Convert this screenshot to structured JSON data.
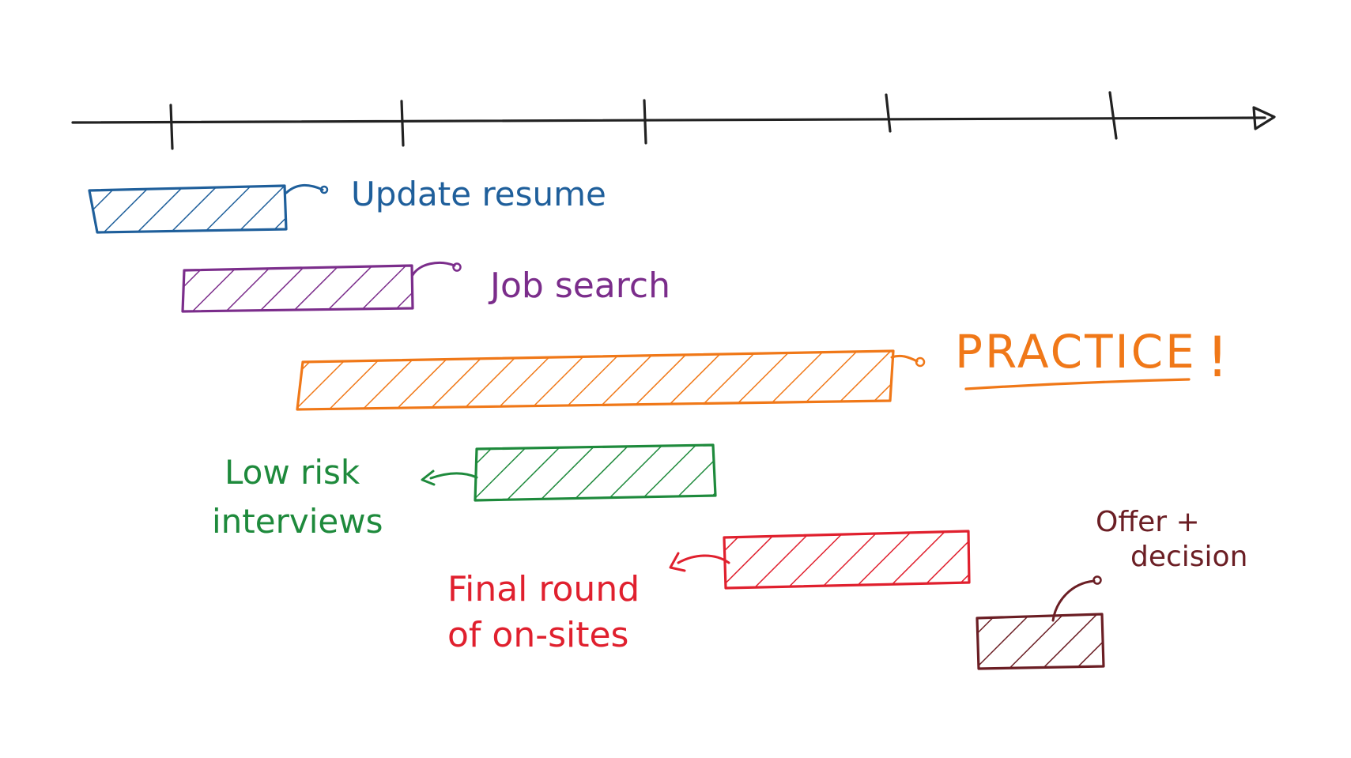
{
  "timeline": {
    "tick_count": 5
  },
  "tasks": [
    {
      "id": "update-resume",
      "label_lines": [
        "Update resume"
      ],
      "color": "#1f5f9b"
    },
    {
      "id": "job-search",
      "label_lines": [
        "Job search"
      ],
      "color": "#7b2d8b"
    },
    {
      "id": "practice",
      "label_lines": [
        "PRACTICE",
        "!"
      ],
      "color": "#f07818"
    },
    {
      "id": "low-risk-interviews",
      "label_lines": [
        "Low risk",
        "interviews"
      ],
      "color": "#1e8a3c"
    },
    {
      "id": "final-round",
      "label_lines": [
        "Final round",
        "of on-sites"
      ],
      "color": "#e0202e"
    },
    {
      "id": "offer-decision",
      "label_lines": [
        "Offer +",
        "decision"
      ],
      "color": "#6b1e24"
    }
  ],
  "colors": {
    "axis": "#222222",
    "background": "#ffffff"
  }
}
